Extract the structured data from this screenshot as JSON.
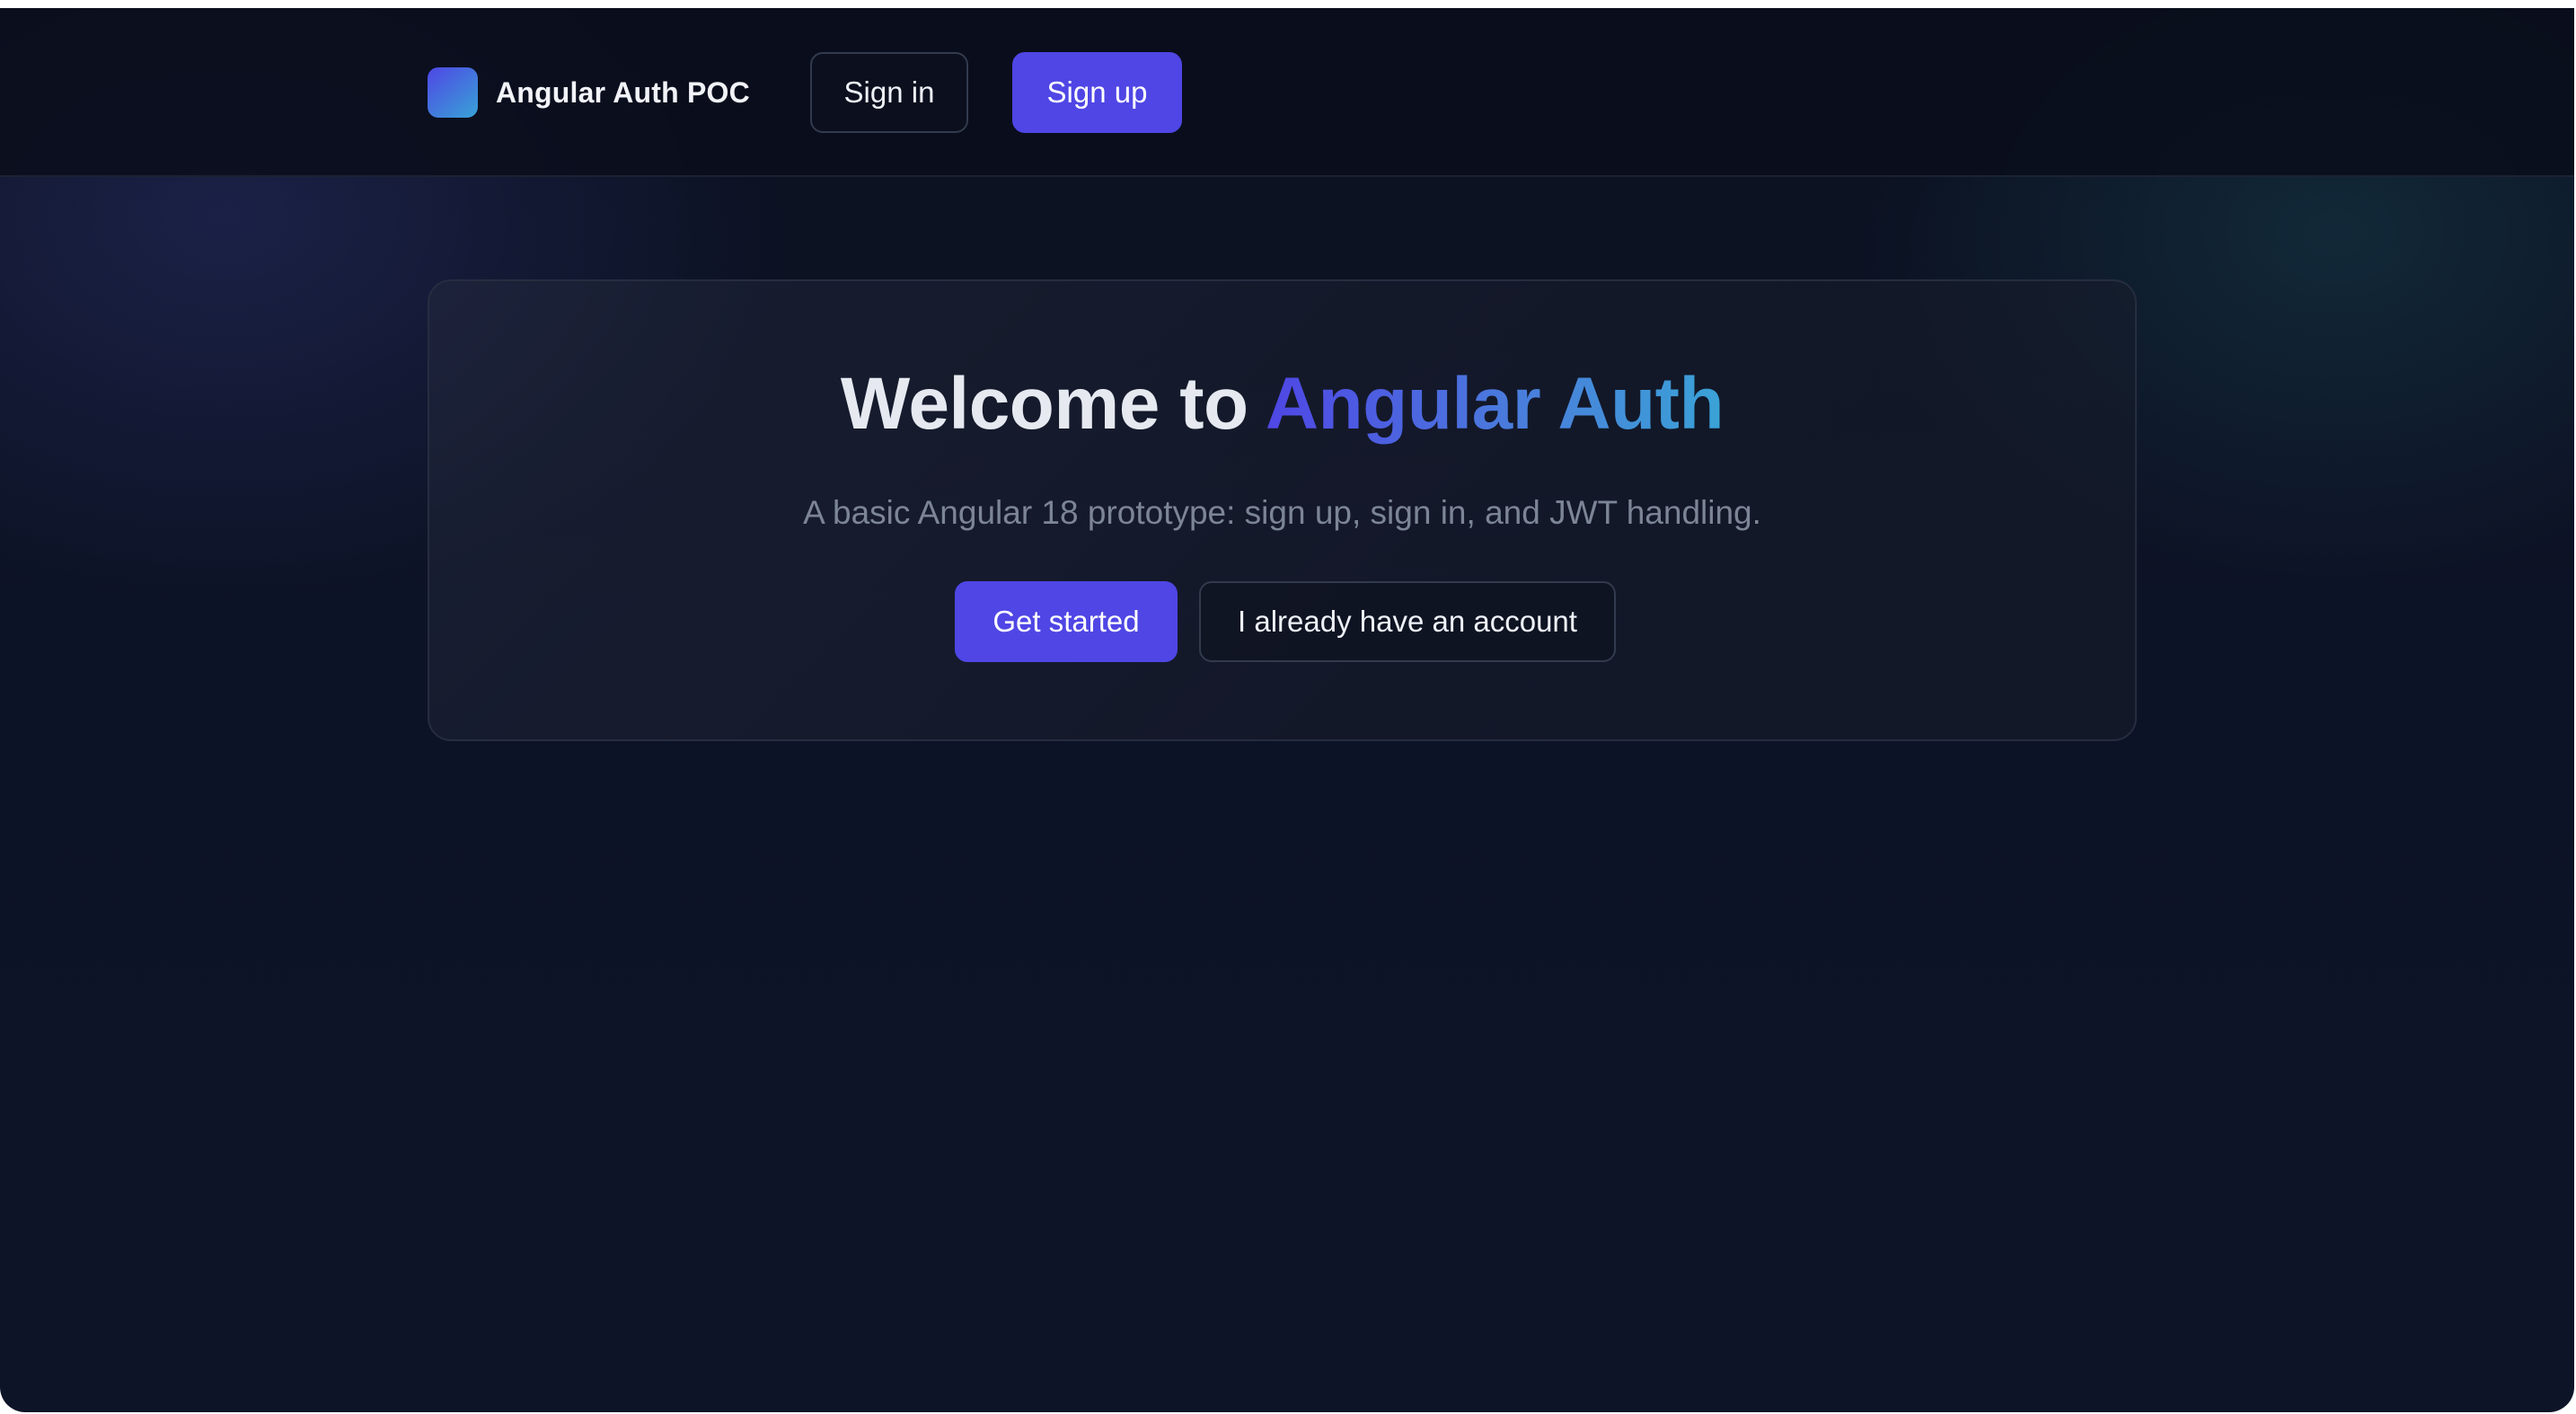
{
  "header": {
    "brand_name": "Angular Auth POC",
    "logo_icon": "gradient-square-logo",
    "signin_label": "Sign in",
    "signup_label": "Sign up"
  },
  "hero": {
    "title_prefix": "Welcome to ",
    "title_accent": "Angular Auth",
    "subtitle": "A basic Angular 18 prototype: sign up, sign in, and JWT handling.",
    "primary_cta": "Get started",
    "secondary_cta": "I already have an account"
  },
  "colors": {
    "background": "#0d1326",
    "accent": "#4f46e5",
    "accent_gradient_end": "#3aa3d6",
    "text_primary": "#e6e9f0",
    "text_muted": "#7c8596",
    "border": "#323a4d"
  }
}
